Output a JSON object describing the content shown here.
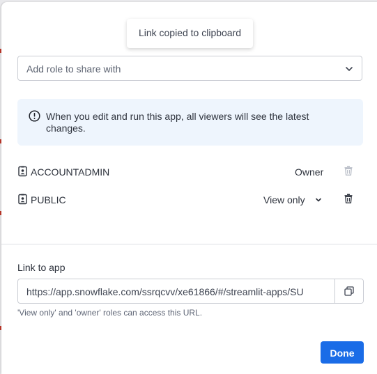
{
  "toast": {
    "text": "Link copied to clipboard"
  },
  "role_select": {
    "placeholder": "Add role to share with",
    "icon": "chevron-down-icon"
  },
  "info_banner": {
    "icon": "info-circle-icon",
    "text": "When you edit and run this app, all viewers will see the latest changes.",
    "color": "#eef5fd"
  },
  "roles": [
    {
      "name": "ACCOUNTADMIN",
      "access": "Owner",
      "icon": "person-badge-icon",
      "delete_icon": "trash-icon",
      "delete_enabled": false
    },
    {
      "name": "PUBLIC",
      "access": "View only",
      "icon": "person-badge-icon",
      "delete_icon": "trash-icon",
      "delete_enabled": true
    }
  ],
  "link": {
    "label": "Link to app",
    "url": "https://app.snowflake.com/ssrqcvv/xe61866/#/streamlit-apps/SU",
    "copy_icon": "copy-icon",
    "hint": "'View only' and 'owner' roles can access this URL."
  },
  "done_button": {
    "label": "Done",
    "color": "#1a6ce7"
  }
}
